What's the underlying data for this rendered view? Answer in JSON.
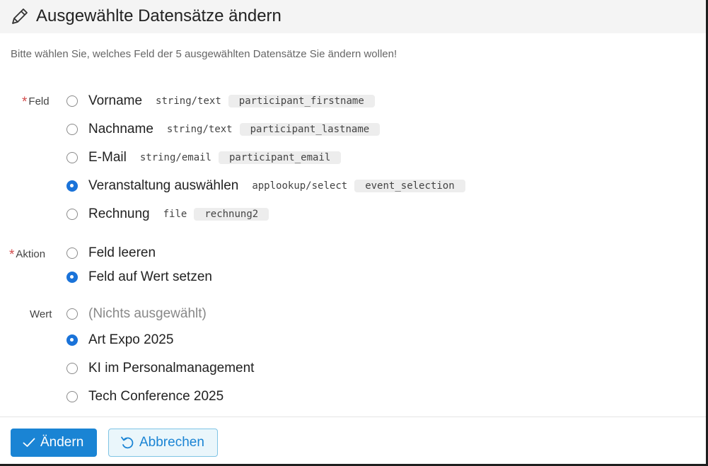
{
  "dialog": {
    "title": "Ausgewählte Datensätze ändern",
    "intro": "Bitte wählen Sie, welches Feld der 5 ausgewählten Datensätze Sie ändern wollen!"
  },
  "field_group": {
    "label": "Feld",
    "required_mark": "*",
    "options": [
      {
        "label": "Vorname",
        "type": "string/text",
        "code": "participant_firstname",
        "checked": false
      },
      {
        "label": "Nachname",
        "type": "string/text",
        "code": "participant_lastname",
        "checked": false
      },
      {
        "label": "E-Mail",
        "type": "string/email",
        "code": "participant_email",
        "checked": false
      },
      {
        "label": "Veranstaltung auswählen",
        "type": "applookup/select",
        "code": "event_selection",
        "checked": true
      },
      {
        "label": "Rechnung",
        "type": "file",
        "code": "rechnung2",
        "checked": false
      }
    ]
  },
  "action_group": {
    "label": "Aktion",
    "required_mark": "*",
    "options": [
      {
        "label": "Feld leeren",
        "checked": false
      },
      {
        "label": "Feld auf Wert setzen",
        "checked": true
      }
    ]
  },
  "value_group": {
    "label": "Wert",
    "options": [
      {
        "label": "(Nichts ausgewählt)",
        "checked": false
      },
      {
        "label": "Art Expo 2025",
        "checked": true
      },
      {
        "label": "KI im Personalmanagement",
        "checked": false
      },
      {
        "label": "Tech Conference 2025",
        "checked": false
      }
    ]
  },
  "footer": {
    "submit_label": "Ändern",
    "cancel_label": "Abbrechen"
  },
  "colors": {
    "accent": "#1a84d4",
    "radio_checked": "#1a73d9",
    "required": "#d24b4b"
  },
  "icons": {
    "header": "pencil-icon",
    "submit": "check-icon",
    "cancel": "undo-icon"
  }
}
